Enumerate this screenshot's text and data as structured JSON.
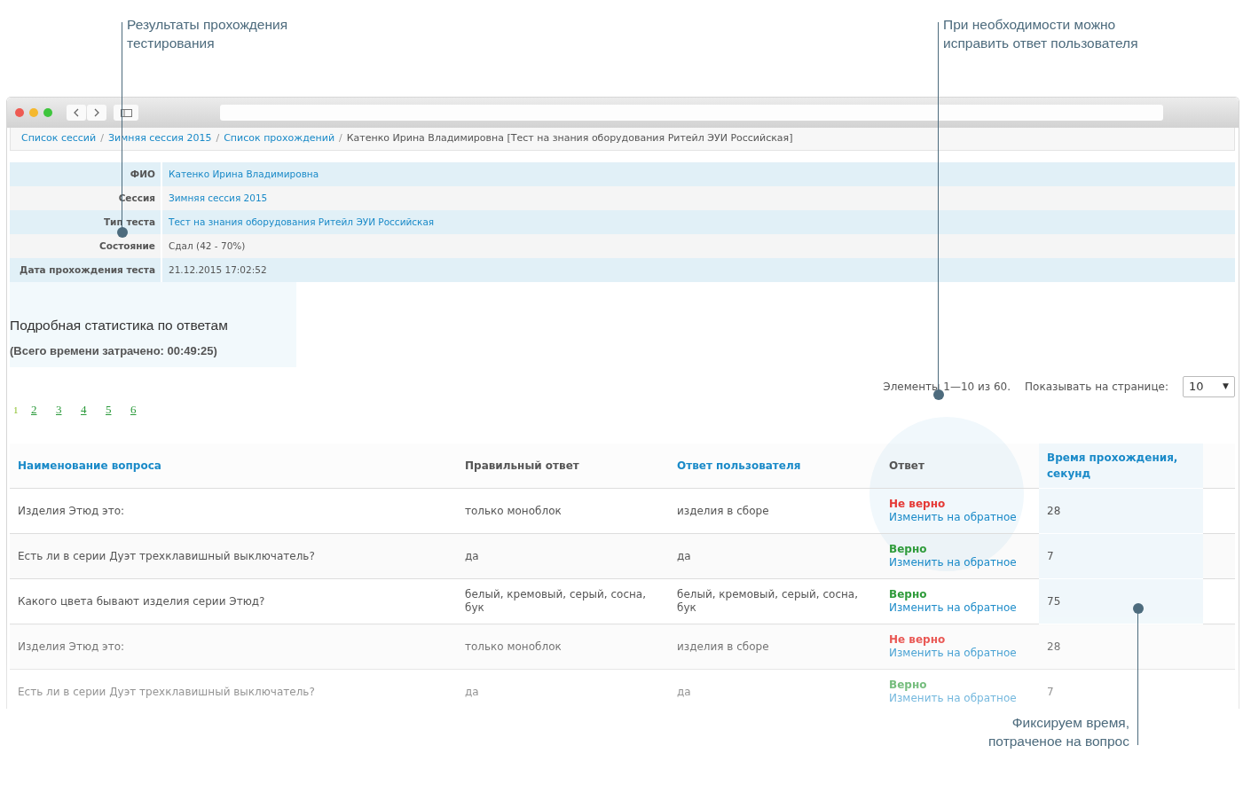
{
  "callouts": [
    {
      "text": "Результаты прохождения тестирования"
    },
    {
      "text": "При необходимости можно исправить ответ пользователя"
    },
    {
      "text": "Фиксируем время, потраченое на вопрос"
    }
  ],
  "breadcrumb": [
    {
      "label": "Список сессий",
      "link": true
    },
    {
      "separator": "/",
      "label": "Зимняя сессия 2015",
      "link": true
    },
    {
      "separator": "/",
      "label": "Список прохождений",
      "link": true
    },
    {
      "separator": "/",
      "label": "Катенко Ирина Владимировна [Тест на знания оборудования Ритейл ЭУИ Российская]",
      "link": false
    }
  ],
  "info": [
    {
      "label": "ФИО",
      "value": "Катенко Ирина Владимировна",
      "link": true
    },
    {
      "label": "Сессия",
      "value": "Зимняя сессия 2015",
      "link": true
    },
    {
      "label": "Тип теста",
      "value": "Тест на знания оборудования Ритейл ЭУИ Российская",
      "link": true
    },
    {
      "label": "Состояние",
      "value": "Сдал (42 - 70%)",
      "link": false
    },
    {
      "label": "Дата прохождения теста",
      "value": "21.12.2015 17:02:52",
      "link": false
    }
  ],
  "stats": {
    "title": "Подробная статистика по ответам",
    "total": "(Всего времени затрачено: 00:49:25)"
  },
  "pages": [
    {
      "label": "1",
      "selected": true
    },
    {
      "label": "2",
      "selected": false
    },
    {
      "label": "3",
      "selected": false
    },
    {
      "label": "4",
      "selected": false
    },
    {
      "label": "5",
      "selected": false
    },
    {
      "label": "6",
      "selected": false
    }
  ],
  "items_info": "Элементы 1—10 из 60.",
  "per_page": {
    "label": "Показывать на странице:",
    "value": "10",
    "arrow": "▼"
  },
  "table": {
    "columns": [
      {
        "label": "Наименование вопроса",
        "sortable": true,
        "highlighted": false
      },
      {
        "label": "Правильный ответ",
        "sortable": false,
        "highlighted": false
      },
      {
        "label": "Ответ пользователя",
        "sortable": true,
        "highlighted": false
      },
      {
        "label": "Ответ",
        "sortable": false,
        "highlighted": false
      },
      {
        "label": "Время прохождения, секунд",
        "sortable": true,
        "highlighted": true
      }
    ],
    "rows": [
      {
        "question": "Изделия Этюд это:",
        "correct_answer": "только моноблок",
        "user_answer": "изделия в сборе",
        "status": "Не верно",
        "is_correct": false,
        "action": "Изменить на обратное",
        "time": "28"
      },
      {
        "question": "Есть ли в серии Дуэт трехклавишный выключатель?",
        "correct_answer": "да",
        "user_answer": "да",
        "status": "Верно",
        "is_correct": true,
        "action": "Изменить на обратное",
        "time": "7"
      },
      {
        "question": "Какого цвета бывают изделия серии Этюд?",
        "correct_answer": "белый, кремовый, серый, сосна, бук",
        "user_answer": "белый, кремовый, серый, сосна, бук",
        "status": "Верно",
        "is_correct": true,
        "action": "Изменить на обратное",
        "time": "75"
      },
      {
        "question": "Изделия Этюд это:",
        "correct_answer": "только моноблок",
        "user_answer": "изделия в сборе",
        "status": "Не верно",
        "is_correct": false,
        "action": "Изменить на обратное",
        "time": "28"
      },
      {
        "question": "Есть ли в серии Дуэт трехклавишный выключатель?",
        "correct_answer": "да",
        "user_answer": "да",
        "status": "Верно",
        "is_correct": true,
        "action": "Изменить на обратное",
        "time": "7"
      }
    ]
  }
}
